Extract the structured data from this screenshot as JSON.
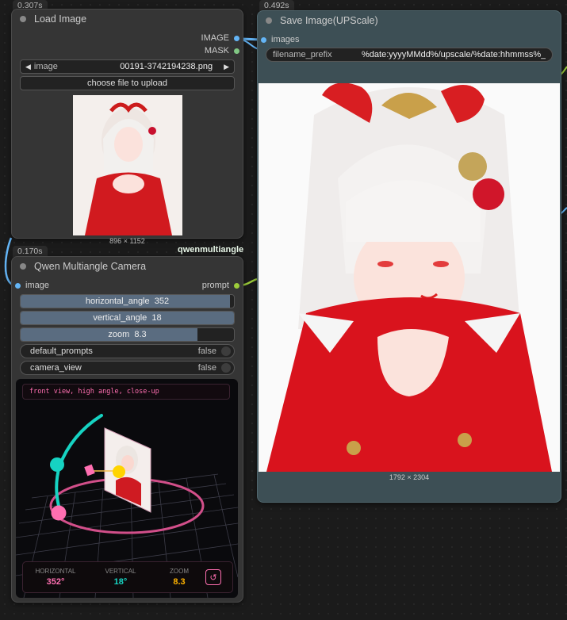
{
  "load_image": {
    "timing": "0.307s",
    "title": "Load Image",
    "output_image": "IMAGE",
    "output_mask": "MASK",
    "image_label": "image",
    "image_value": "00191-3742194238.png",
    "upload_label": "choose file to upload",
    "dims": "896 × 1152"
  },
  "qwen": {
    "timing": "0.170s",
    "badge": "qwenmultiangle",
    "title": "Qwen Multiangle Camera",
    "input_image": "image",
    "output_prompt": "prompt",
    "horizontal_label": "horizontal_angle",
    "horizontal_value": "352",
    "horizontal_fraction": 0.98,
    "vertical_label": "vertical_angle",
    "vertical_value": "18",
    "vertical_fraction": 1.0,
    "zoom_label": "zoom",
    "zoom_value": "8.3",
    "zoom_fraction": 0.83,
    "default_prompts_label": "default_prompts",
    "default_prompts_value": "false",
    "camera_view_label": "camera_view",
    "camera_view_value": "false",
    "prompt_text": "front view, high angle, close-up",
    "readout": {
      "h_label": "HORIZONTAL",
      "h_value": "352°",
      "v_label": "VERTICAL",
      "v_value": "18°",
      "z_label": "ZOOM",
      "z_value": "8.3"
    }
  },
  "save_image": {
    "timing": "0.492s",
    "title": "Save Image(UPScale)",
    "input_images": "images",
    "prefix_label": "filename_prefix",
    "prefix_value": "%date:yyyyMMdd%/upscale/%date:hhmmss%_",
    "dims": "1792 × 2304"
  },
  "colors": {
    "image_port": "#64b5f6",
    "mask_port": "#81c784",
    "prompt_port": "#9ccc3a",
    "pink": "#ff6fb1",
    "teal": "#18d6c4",
    "gold": "#ffb300"
  }
}
